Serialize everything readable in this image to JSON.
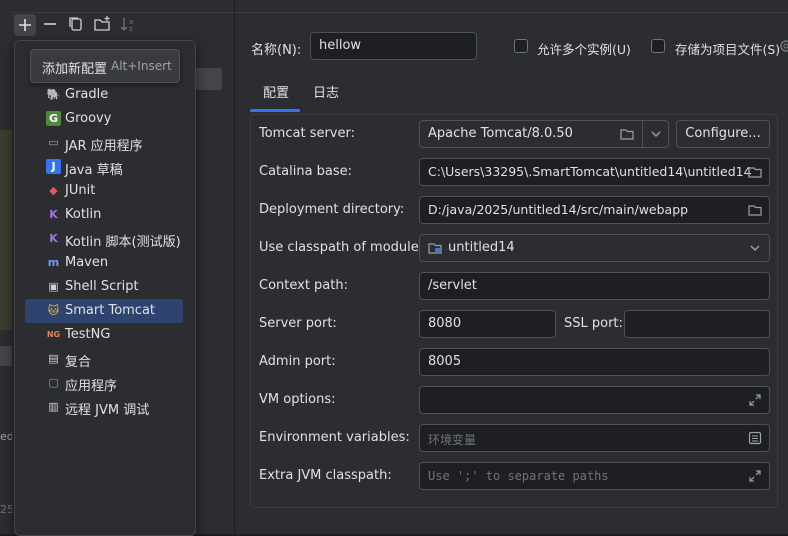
{
  "toolbar": {
    "add_icon": "plus-icon",
    "remove_icon": "minus-icon",
    "copy_icon": "copy-icon",
    "folder_icon": "new-folder-icon",
    "sort_icon": "sort-icon"
  },
  "tooltip": {
    "title": "添加新配置",
    "shortcut": "Alt+Insert"
  },
  "menu": {
    "items": [
      {
        "label": "Gradle",
        "icon": "gradle-icon",
        "selected": false
      },
      {
        "label": "Groovy",
        "icon": "groovy-icon",
        "selected": false
      },
      {
        "label": "JAR 应用程序",
        "icon": "jar-icon",
        "selected": false
      },
      {
        "label": "Java 草稿",
        "icon": "java-scratch-icon",
        "selected": false
      },
      {
        "label": "JUnit",
        "icon": "junit-icon",
        "selected": false
      },
      {
        "label": "Kotlin",
        "icon": "kotlin-icon",
        "selected": false
      },
      {
        "label": "Kotlin 脚本(测试版)",
        "icon": "kotlin-script-icon",
        "selected": false
      },
      {
        "label": "Maven",
        "icon": "maven-icon",
        "selected": false
      },
      {
        "label": "Shell Script",
        "icon": "shell-script-icon",
        "selected": false
      },
      {
        "label": "Smart Tomcat",
        "icon": "tomcat-icon",
        "selected": true
      },
      {
        "label": "TestNG",
        "icon": "testng-icon",
        "selected": false
      },
      {
        "label": "复合",
        "icon": "compound-icon",
        "selected": false
      },
      {
        "label": "应用程序",
        "icon": "application-icon",
        "selected": false
      },
      {
        "label": "远程 JVM 调试",
        "icon": "remote-jvm-debug-icon",
        "selected": false
      }
    ]
  },
  "left_edge": {
    "fragment1": "es",
    "fragment2": "ed",
    "fragment3": "25"
  },
  "header": {
    "name_label": "名称(N):",
    "name_value": "hellow",
    "allow_parallel_label": "允许多个实例(U)",
    "store_as_file_label": "存储为项目文件(S)"
  },
  "tabs": {
    "config": "配置",
    "logs": "日志"
  },
  "form": {
    "tomcat_server_label": "Tomcat server:",
    "tomcat_server_value": "Apache Tomcat/8.0.50",
    "configure_button": "Configure...",
    "catalina_base_label": "Catalina base:",
    "catalina_base_value": "C:\\Users\\33295\\.SmartTomcat\\untitled14\\untitled14",
    "deployment_dir_label": "Deployment directory:",
    "deployment_dir_value": "D:/java/2025/untitled14/src/main/webapp",
    "classpath_module_label": "Use classpath of module:",
    "classpath_module_value": "untitled14",
    "context_path_label": "Context path:",
    "context_path_value": "/servlet",
    "server_port_label": "Server port:",
    "server_port_value": "8080",
    "ssl_port_label": "SSL port:",
    "ssl_port_value": "",
    "admin_port_label": "Admin port:",
    "admin_port_value": "8005",
    "vm_options_label": "VM options:",
    "vm_options_value": "",
    "env_vars_label": "Environment variables:",
    "env_vars_placeholder": "环境变量",
    "extra_classpath_label": "Extra JVM classpath:",
    "extra_classpath_placeholder": "Use ';' to separate paths"
  },
  "colors": {
    "background": "#2b2d30",
    "field_background": "#1e1f22",
    "selection": "#2e436e",
    "accent": "#3574f0"
  }
}
